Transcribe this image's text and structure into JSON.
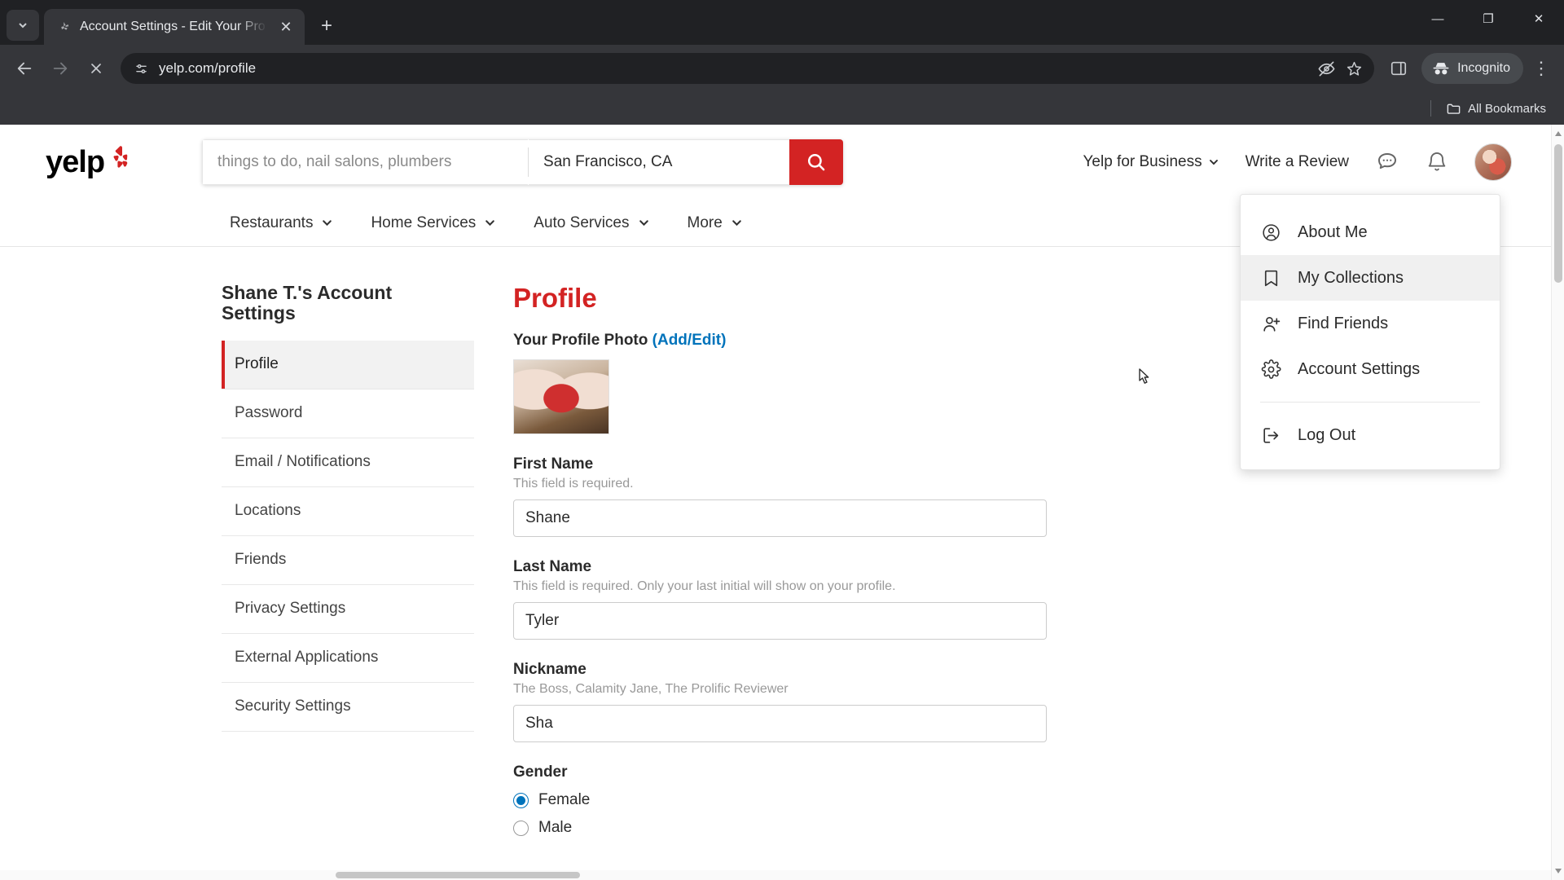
{
  "browser": {
    "tab": {
      "title": "Account Settings - Edit Your Pro",
      "favicon_name": "yelp-favicon",
      "close_label": "✕"
    },
    "new_tab_label": "+",
    "tab_search_name": "tab-search-chevron-icon",
    "window_controls": {
      "minimize": "—",
      "maximize": "❐",
      "close": "✕"
    },
    "toolbar": {
      "back_label": "←",
      "forward_label": "→",
      "stop_label": "✕",
      "url": "yelp.com/profile",
      "site_info_icon": "page-info-icon",
      "tracking_icon": "eye-slash-icon",
      "bookmark_icon": "star-icon",
      "side_panel_icon": "side-panel-icon",
      "profile_label": "Incognito",
      "profile_icon": "incognito-hat-icon",
      "menu_icon": "three-dot-menu-icon"
    },
    "bookmarks": {
      "all_bookmarks_label": "All Bookmarks",
      "folder_icon": "folder-icon"
    }
  },
  "page": {
    "logo_text": "yelp",
    "search": {
      "things_placeholder": "things to do, nail salons, plumbers",
      "location_value": "San Francisco, CA",
      "submit_icon": "search-icon",
      "accent_color": "#d32323"
    },
    "header_links": [
      {
        "label": "Yelp for Business",
        "has_chevron": true
      },
      {
        "label": "Write a Review",
        "has_chevron": false
      }
    ],
    "header_icons": [
      {
        "name": "messages-icon"
      },
      {
        "name": "notifications-bell-icon"
      },
      {
        "name": "user-avatar"
      }
    ],
    "categories": [
      {
        "label": "Restaurants"
      },
      {
        "label": "Home Services"
      },
      {
        "label": "Auto Services"
      },
      {
        "label": "More"
      }
    ],
    "sidebar": {
      "title": "Shane T.'s Account Settings",
      "items": [
        {
          "label": "Profile",
          "active": true
        },
        {
          "label": "Password",
          "active": false
        },
        {
          "label": "Email / Notifications",
          "active": false
        },
        {
          "label": "Locations",
          "active": false
        },
        {
          "label": "Friends",
          "active": false
        },
        {
          "label": "Privacy Settings",
          "active": false
        },
        {
          "label": "External Applications",
          "active": false
        },
        {
          "label": "Security Settings",
          "active": false
        }
      ]
    },
    "main": {
      "title": "Profile",
      "photo": {
        "label": "Your Profile Photo",
        "edit_link": "(Add/Edit)"
      },
      "fields": [
        {
          "label": "First Name",
          "help": "This field is required.",
          "value": "Shane"
        },
        {
          "label": "Last Name",
          "help": "This field is required. Only your last initial will show on your profile.",
          "value": "Tyler"
        },
        {
          "label": "Nickname",
          "help": "The Boss, Calamity Jane, The Prolific Reviewer",
          "value": "Sha"
        }
      ],
      "gender": {
        "label": "Gender",
        "options": [
          {
            "label": "Female",
            "selected": true
          },
          {
            "label": "Male",
            "selected": false
          }
        ]
      }
    },
    "user_menu": [
      {
        "label": "About Me",
        "icon": "about-me-icon",
        "hover": false
      },
      {
        "label": "My Collections",
        "icon": "bookmark-icon",
        "hover": true
      },
      {
        "label": "Find Friends",
        "icon": "add-friend-icon",
        "hover": false
      },
      {
        "label": "Account Settings",
        "icon": "gear-icon",
        "hover": false
      },
      {
        "label": "Log Out",
        "icon": "logout-icon",
        "hover": false,
        "after_divider": true
      }
    ]
  }
}
